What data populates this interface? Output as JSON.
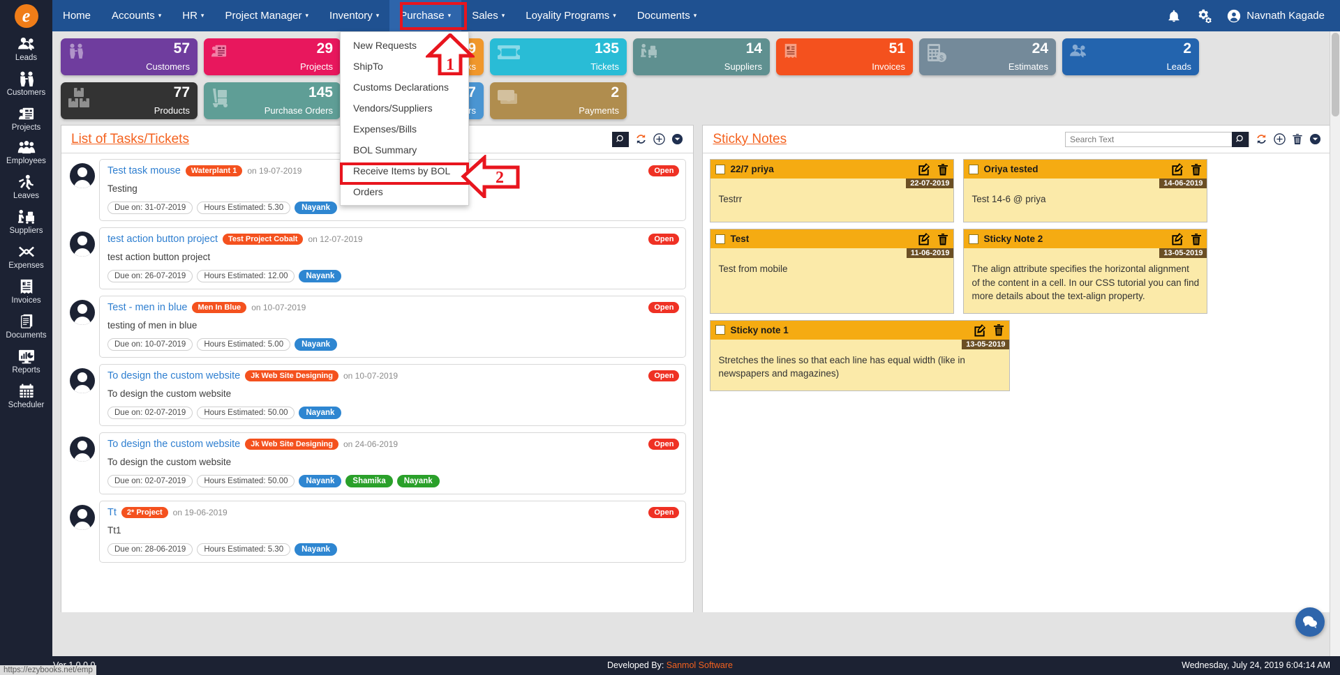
{
  "app": {
    "version": "Ver 1.0.0.0",
    "status_url": "https://ezybooks.net/emp"
  },
  "topnav": {
    "items": [
      {
        "label": "Home",
        "caret": false
      },
      {
        "label": "Accounts",
        "caret": true
      },
      {
        "label": "HR",
        "caret": true
      },
      {
        "label": "Project Manager",
        "caret": true
      },
      {
        "label": "Inventory",
        "caret": true
      },
      {
        "label": "Purchase",
        "caret": true
      },
      {
        "label": "Sales",
        "caret": true
      },
      {
        "label": "Loyality Programs",
        "caret": true
      },
      {
        "label": "Documents",
        "caret": true
      }
    ],
    "caret_glyph": "▾",
    "user_name": "Navnath Kagade",
    "accent_blue": "#1f5191",
    "active_blue": "#2e65ab"
  },
  "dropdown": {
    "parent": "Purchase",
    "items": [
      "New Requests",
      "ShipTo",
      "Customs Declarations",
      "Vendors/Suppliers",
      "Expenses/Bills",
      "BOL Summary",
      "Receive Items by BOL",
      "Orders"
    ],
    "highlighted_item": "Orders",
    "highlight_color": "#e8151e"
  },
  "annotations": [
    {
      "number": "1",
      "points_to": "Purchase menu"
    },
    {
      "number": "2",
      "points_to": "Orders menu item"
    }
  ],
  "sidebar": {
    "items": [
      {
        "label": "Leads",
        "icon": "leads-icon"
      },
      {
        "label": "Customers",
        "icon": "customers-icon"
      },
      {
        "label": "Projects",
        "icon": "projects-icon"
      },
      {
        "label": "Employees",
        "icon": "employees-icon"
      },
      {
        "label": "Leaves",
        "icon": "leaves-icon"
      },
      {
        "label": "Suppliers",
        "icon": "suppliers-icon"
      },
      {
        "label": "Expenses",
        "icon": "expenses-icon"
      },
      {
        "label": "Invoices",
        "icon": "invoices-icon"
      },
      {
        "label": "Documents",
        "icon": "documents-icon"
      },
      {
        "label": "Reports",
        "icon": "reports-icon"
      },
      {
        "label": "Scheduler",
        "icon": "scheduler-icon"
      }
    ]
  },
  "tiles": [
    {
      "count": "57",
      "label": "Customers",
      "color": "#6f3d9e",
      "icon": "customers-icon"
    },
    {
      "count": "29",
      "label": "Projects",
      "color": "#e8175d",
      "icon": "projects-icon"
    },
    {
      "count": "9",
      "label": "Tasks",
      "color": "#f0972b",
      "icon": "tasks-icon"
    },
    {
      "count": "135",
      "label": "Tickets",
      "color": "#29bcd6",
      "icon": "tickets-icon"
    },
    {
      "count": "14",
      "label": "Suppliers",
      "color": "#5f9090",
      "icon": "suppliers-icon"
    },
    {
      "count": "51",
      "label": "Invoices",
      "color": "#f4511e",
      "icon": "invoices-icon"
    },
    {
      "count": "24",
      "label": "Estimates",
      "color": "#748a9a",
      "icon": "estimates-icon"
    },
    {
      "count": "2",
      "label": "Leads",
      "color": "#2364ae",
      "icon": "leads-icon"
    },
    {
      "count": "77",
      "label": "Products",
      "color": "#333333",
      "icon": "products-icon"
    },
    {
      "count": "145",
      "label": "Purchase Orders",
      "color": "#5f9e96",
      "icon": "purchase-orders-icon"
    },
    {
      "count": "467",
      "label": "Sales Orders",
      "color": "#4a95d2",
      "icon": "sales-orders-icon"
    },
    {
      "count": "2",
      "label": "Payments",
      "color": "#b08d4e",
      "icon": "payments-icon"
    }
  ],
  "tasks_panel": {
    "title": "List of Tasks/Tickets",
    "tools": [
      "search-icon",
      "refresh-icon",
      "add-icon",
      "chevron-down-icon"
    ],
    "tasks": [
      {
        "title": "Test task mouse",
        "project": "Waterplant 1",
        "on": "on 19-07-2019",
        "desc": "Testing",
        "due": "Due on: 31-07-2019",
        "hours": "Hours Estimated: 5.30",
        "users": [
          {
            "name": "Nayank",
            "color": "blue"
          }
        ],
        "status": "Open"
      },
      {
        "title": "test action button project",
        "project": "Test Project Cobalt",
        "on": "on 12-07-2019",
        "desc": "test action button project",
        "due": "Due on: 26-07-2019",
        "hours": "Hours Estimated: 12.00",
        "users": [
          {
            "name": "Nayank",
            "color": "blue"
          }
        ],
        "status": "Open"
      },
      {
        "title": "Test - men in blue",
        "project": "Men In Blue",
        "on": "on 10-07-2019",
        "desc": "testing of men in blue",
        "due": "Due on: 10-07-2019",
        "hours": "Hours Estimated: 5.00",
        "users": [
          {
            "name": "Nayank",
            "color": "blue"
          }
        ],
        "status": "Open"
      },
      {
        "title": "To design the custom website",
        "project": "Jk Web Site Designing",
        "on": "on 10-07-2019",
        "desc": "To design the custom website",
        "due": "Due on: 02-07-2019",
        "hours": "Hours Estimated: 50.00",
        "users": [
          {
            "name": "Nayank",
            "color": "blue"
          }
        ],
        "status": "Open"
      },
      {
        "title": "To design the custom website",
        "project": "Jk Web Site Designing",
        "on": "on 24-06-2019",
        "desc": "To design the custom website",
        "due": "Due on: 02-07-2019",
        "hours": "Hours Estimated: 50.00",
        "users": [
          {
            "name": "Nayank",
            "color": "blue"
          },
          {
            "name": "Shamika",
            "color": "green"
          },
          {
            "name": "Nayank",
            "color": "green"
          }
        ],
        "status": "Open"
      },
      {
        "title": "Tt",
        "project": "2* Project",
        "on": "on 19-06-2019",
        "desc": "Tt1",
        "due": "Due on: 28-06-2019",
        "hours": "Hours Estimated: 5.30",
        "users": [
          {
            "name": "Nayank",
            "color": "blue"
          }
        ],
        "status": "Open"
      }
    ]
  },
  "notes_panel": {
    "title": "Sticky Notes",
    "search_value": "",
    "search_placeholder": "Search Text",
    "tools": [
      "search-icon",
      "refresh-icon",
      "add-icon",
      "delete-icon",
      "chevron-down-icon"
    ],
    "notes": [
      {
        "title": "22/7 priya",
        "date": "22-07-2019",
        "text": "Testrr"
      },
      {
        "title": "Oriya tested",
        "date": "14-06-2019",
        "text": "Test 14-6 @ priya"
      },
      {
        "title": "Test",
        "date": "11-06-2019",
        "text": "Test from mobile"
      },
      {
        "title": "Sticky Note 2",
        "date": "13-05-2019",
        "text": "The align attribute specifies the horizontal alignment of the content in a cell. In our CSS tutorial you can find more details about the text-align property."
      },
      {
        "title": "Sticky note 1",
        "date": "13-05-2019",
        "text": "Stretches the lines so that each line has equal width (like in newspapers and magazines)"
      }
    ]
  },
  "footer": {
    "version": "Ver 1.0.0.0",
    "developed_by_label": "Developed By:",
    "developer": "Sanmol Software",
    "datetime": "Wednesday, July 24, 2019 6:04:14 AM"
  }
}
